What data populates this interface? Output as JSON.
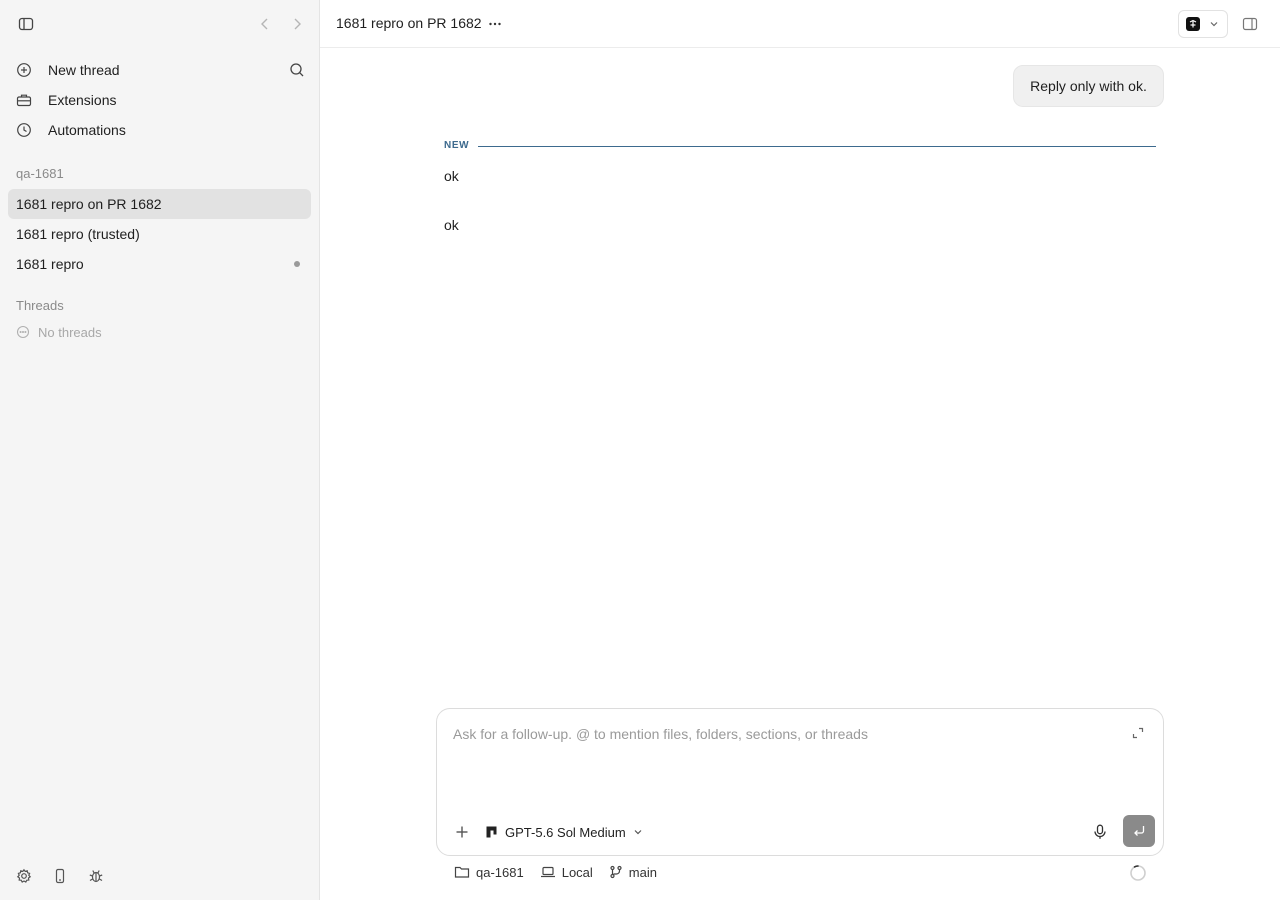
{
  "sidebar": {
    "nav": [
      {
        "label": "New thread",
        "icon": "plus-circle-icon"
      },
      {
        "label": "Extensions",
        "icon": "toolbox-icon"
      },
      {
        "label": "Automations",
        "icon": "clock-icon"
      }
    ],
    "project_label": "qa-1681",
    "project_threads": [
      {
        "label": "1681 repro on PR 1682",
        "active": true
      },
      {
        "label": "1681 repro (trusted)",
        "active": false
      },
      {
        "label": "1681 repro",
        "active": false,
        "unread": true
      }
    ],
    "threads_label": "Threads",
    "no_threads_label": "No threads"
  },
  "header": {
    "title": "1681 repro on PR 1682"
  },
  "conversation": {
    "user_message": "Reply only with ok.",
    "new_marker": "NEW",
    "replies": [
      "ok",
      "ok"
    ]
  },
  "composer": {
    "placeholder": "Ask for a follow-up. @ to mention files, folders, sections, or threads",
    "value": "",
    "model_label": "GPT-5.6 Sol Medium"
  },
  "footer": {
    "folder": "qa-1681",
    "environment": "Local",
    "branch": "main"
  },
  "colors": {
    "accent_divider": "#3d6a8e",
    "sidebar_bg": "#f5f5f5",
    "active_item_bg": "#e2e2e2",
    "send_button": "#8a8a8a"
  }
}
